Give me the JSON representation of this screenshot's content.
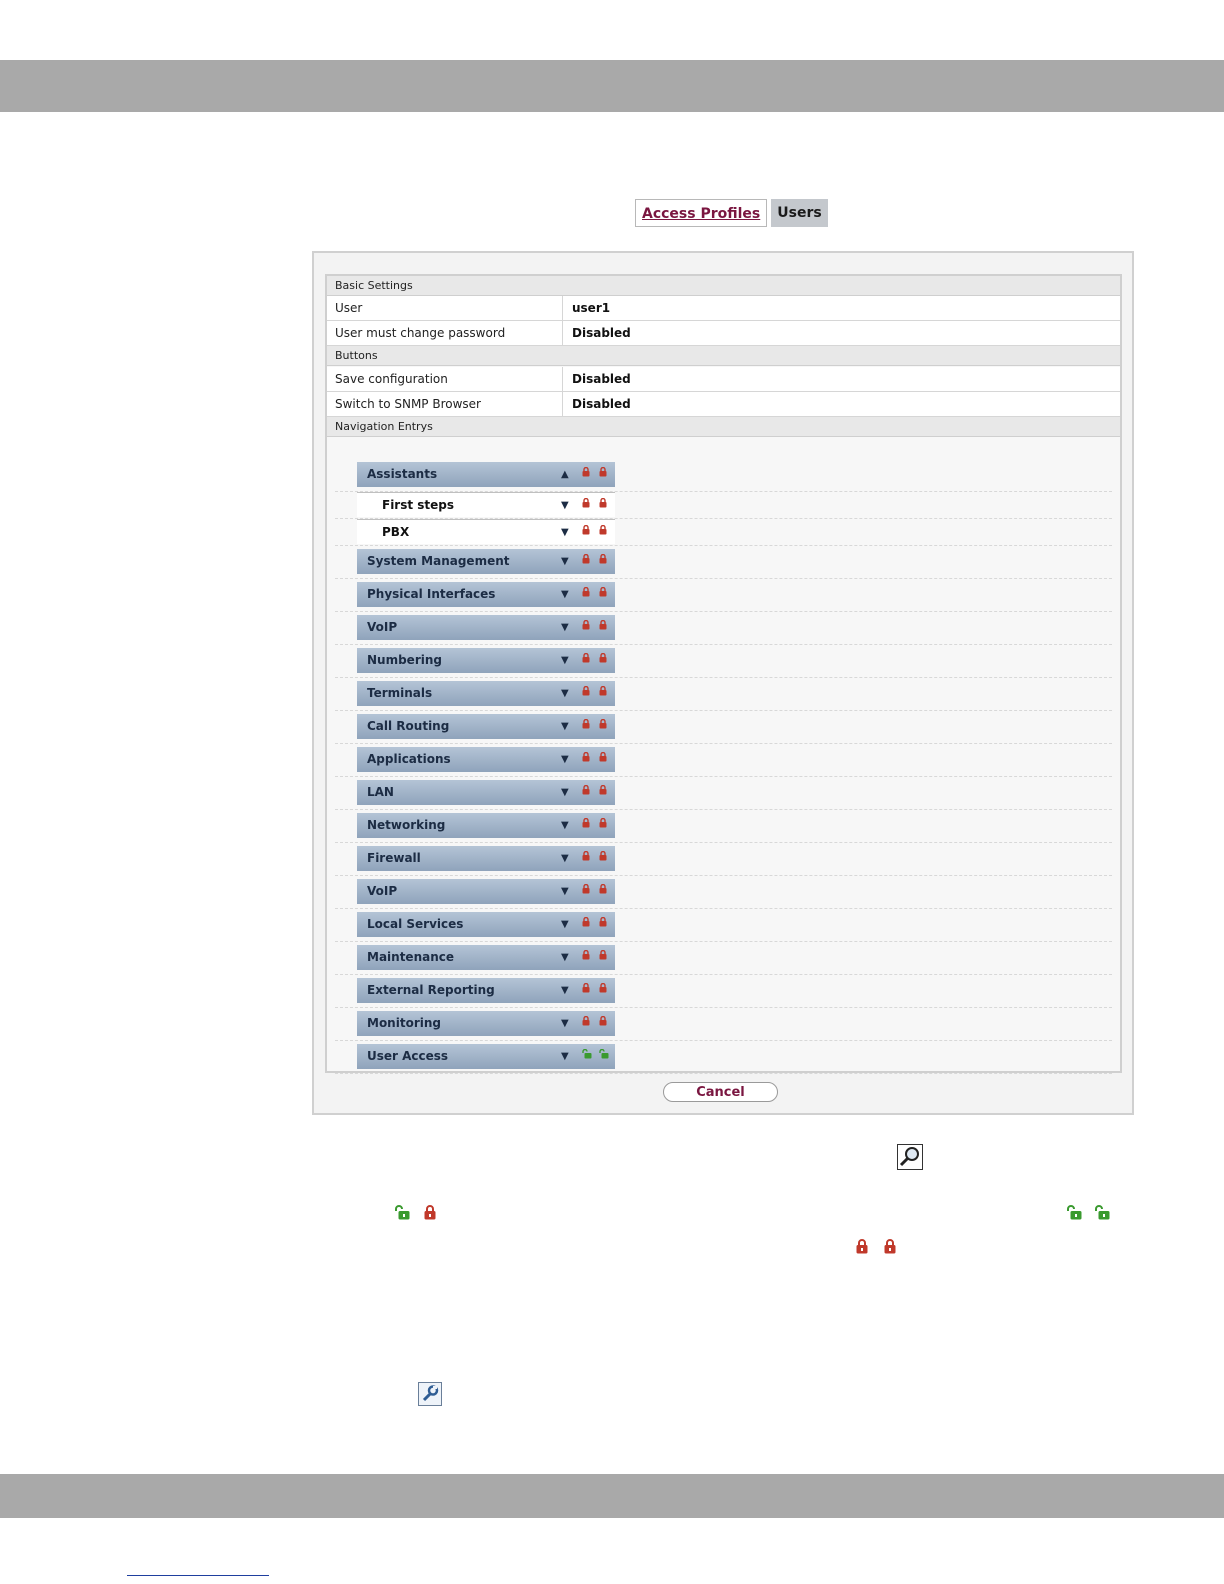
{
  "tabs": [
    {
      "label": "Access Profiles",
      "active": false
    },
    {
      "label": "Users",
      "active": true
    }
  ],
  "basic_settings": {
    "header": "Basic Settings",
    "rows": [
      {
        "label": "User",
        "value": "user1"
      },
      {
        "label": "User must change password",
        "value": "Disabled"
      }
    ]
  },
  "buttons_section": {
    "header": "Buttons",
    "rows": [
      {
        "label": "Save configuration",
        "value": "Disabled"
      },
      {
        "label": "Switch to SNMP Browser",
        "value": "Disabled"
      }
    ]
  },
  "navigation": {
    "header": "Navigation Entrys",
    "items": [
      {
        "label": "Assistants",
        "sub": false,
        "expanded": true,
        "locked": true
      },
      {
        "label": "First steps",
        "sub": true,
        "expanded": false,
        "locked": true
      },
      {
        "label": "PBX",
        "sub": true,
        "expanded": false,
        "locked": true
      },
      {
        "label": "System Management",
        "sub": false,
        "expanded": false,
        "locked": true
      },
      {
        "label": "Physical Interfaces",
        "sub": false,
        "expanded": false,
        "locked": true
      },
      {
        "label": "VoIP",
        "sub": false,
        "expanded": false,
        "locked": true
      },
      {
        "label": "Numbering",
        "sub": false,
        "expanded": false,
        "locked": true
      },
      {
        "label": "Terminals",
        "sub": false,
        "expanded": false,
        "locked": true
      },
      {
        "label": "Call Routing",
        "sub": false,
        "expanded": false,
        "locked": true
      },
      {
        "label": "Applications",
        "sub": false,
        "expanded": false,
        "locked": true
      },
      {
        "label": "LAN",
        "sub": false,
        "expanded": false,
        "locked": true
      },
      {
        "label": "Networking",
        "sub": false,
        "expanded": false,
        "locked": true
      },
      {
        "label": "Firewall",
        "sub": false,
        "expanded": false,
        "locked": true
      },
      {
        "label": "VoIP",
        "sub": false,
        "expanded": false,
        "locked": true
      },
      {
        "label": "Local Services",
        "sub": false,
        "expanded": false,
        "locked": true
      },
      {
        "label": "Maintenance",
        "sub": false,
        "expanded": false,
        "locked": true
      },
      {
        "label": "External Reporting",
        "sub": false,
        "expanded": false,
        "locked": true
      },
      {
        "label": "Monitoring",
        "sub": false,
        "expanded": false,
        "locked": true
      },
      {
        "label": "User Access",
        "sub": false,
        "expanded": false,
        "locked": false
      }
    ]
  },
  "cancel_label": "Cancel",
  "icons": {
    "locked": "lock-closed-icon",
    "unlocked": "lock-open-icon",
    "magnifier": "magnifier-icon",
    "wrench": "wrench-icon"
  },
  "colors": {
    "lock_red": "#c0392b",
    "lock_green": "#3a9a2f",
    "band_gray": "#a9a9a9",
    "nav_blue": "#9fb1c7"
  }
}
